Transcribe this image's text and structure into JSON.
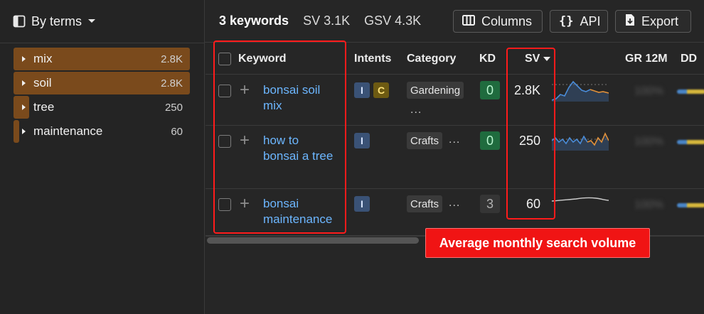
{
  "sidebar": {
    "group_by_label": "By terms",
    "items": [
      {
        "label": "mix",
        "count": "2.8K",
        "share": 1.0
      },
      {
        "label": "soil",
        "count": "2.8K",
        "share": 1.0
      },
      {
        "label": "tree",
        "count": "250",
        "share": 0.09
      },
      {
        "label": "maintenance",
        "count": "60",
        "share": 0.02
      }
    ]
  },
  "header": {
    "keywords_count": "3 keywords",
    "sv_total": "SV 3.1K",
    "gsv_total": "GSV 4.3K",
    "columns_label": "Columns",
    "api_label": "API",
    "export_label": "Export"
  },
  "table": {
    "columns": {
      "keyword": "Keyword",
      "intents": "Intents",
      "category": "Category",
      "kd": "KD",
      "sv": "SV",
      "gr12m": "GR 12M",
      "dd": "DD"
    },
    "rows": [
      {
        "keyword_line1": "bonsai soil",
        "keyword_line2": "mix",
        "intents": [
          "I",
          "C"
        ],
        "category": "Gardening",
        "category_more": "...",
        "kd": "0",
        "sv": "2.8K",
        "gr12m": "100%"
      },
      {
        "keyword_line1": "how to",
        "keyword_line2": "bonsai a tree",
        "intents": [
          "I"
        ],
        "category": "Crafts",
        "category_more": "...",
        "kd": "0",
        "sv": "250",
        "gr12m": "100%"
      },
      {
        "keyword_line1": "bonsai",
        "keyword_line2": "maintenance",
        "intents": [
          "I"
        ],
        "category": "Crafts",
        "category_more": "...",
        "kd": "3",
        "sv": "60",
        "gr12m": "100%"
      }
    ]
  },
  "annotation": {
    "callout_text": "Average monthly search volume",
    "highlight_color": "#ff1b1b"
  },
  "colors": {
    "background": "#262626",
    "term_bar": "#7a4a1c",
    "link": "#6cb6ff",
    "kd_easy": "#1f6b3e",
    "intent_informational": "#3a5276",
    "intent_commercial": "#6d5a12"
  }
}
